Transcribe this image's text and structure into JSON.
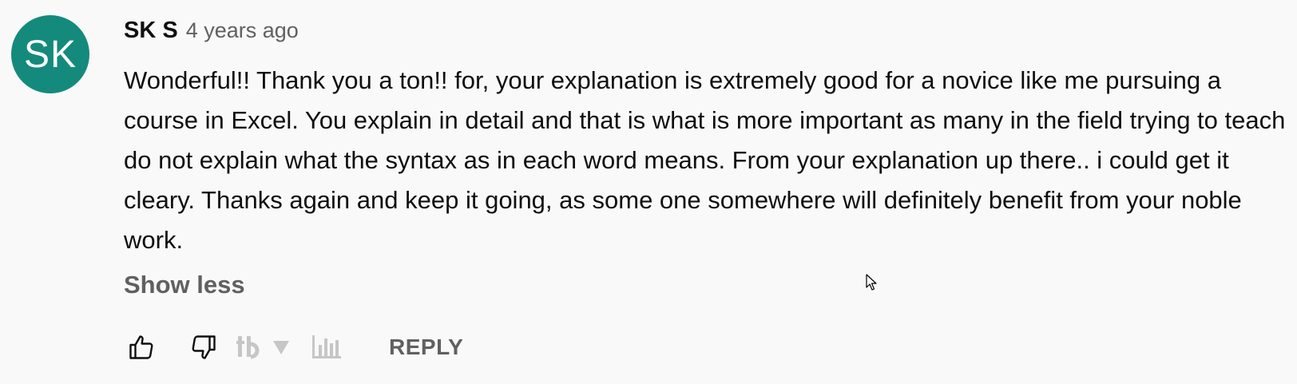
{
  "comment": {
    "avatar_initials": "SK",
    "avatar_color": "#148a7c",
    "author": "SK S",
    "timestamp": "4 years ago",
    "text": "Wonderful!! Thank you a ton!! for, your explanation is extremely good for a novice like me pursuing a course in Excel. You explain in detail and that is what is more important as many in the field trying to teach do not explain what the syntax as in each word means. From your explanation up there.. i could get it cleary. Thanks again and keep it going, as some one somewhere will definitely benefit from your noble work.",
    "show_less_label": "Show less"
  },
  "actions": {
    "like_icon": "thumbs-up-icon",
    "dislike_icon": "thumbs-down-icon",
    "extension_icon": "tb-extension-icon",
    "dropdown_icon": "triangle-down-icon",
    "stats_icon": "bar-chart-icon",
    "reply_label": "REPLY"
  }
}
